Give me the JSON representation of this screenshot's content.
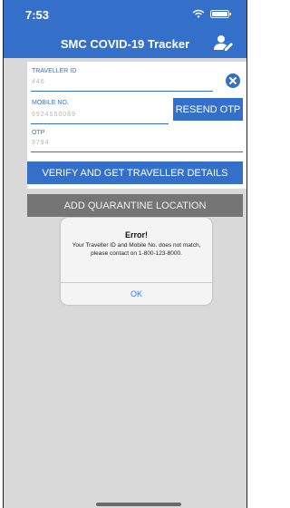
{
  "status_bar": {
    "time": "7:53"
  },
  "header": {
    "title": "SMC COVID-19 Tracker"
  },
  "form": {
    "traveller_id": {
      "label": "TRAVELLER ID",
      "value": "446"
    },
    "mobile": {
      "label": "MOBILE NO.",
      "value": "9924550089"
    },
    "otp": {
      "label": "OTP",
      "value": "9794"
    },
    "resend_label": "RESEND OTP"
  },
  "actions": {
    "verify_label": "VERIFY AND GET TRAVELLER DETAILS",
    "add_location_label": "ADD QUARANTINE LOCATION"
  },
  "alert": {
    "title": "Error!",
    "message": "Your Traveller ID and Mobile No. does not match, please contact on 1-800-123-8000.",
    "ok_label": "OK"
  },
  "colors": {
    "primary": "#3470c9",
    "secondary_button": "#757575",
    "background": "#d9d9d9",
    "alert_link": "#3478f6"
  },
  "icons": [
    "wifi-icon",
    "battery-icon",
    "user-edit-icon",
    "clear-circle-icon"
  ]
}
